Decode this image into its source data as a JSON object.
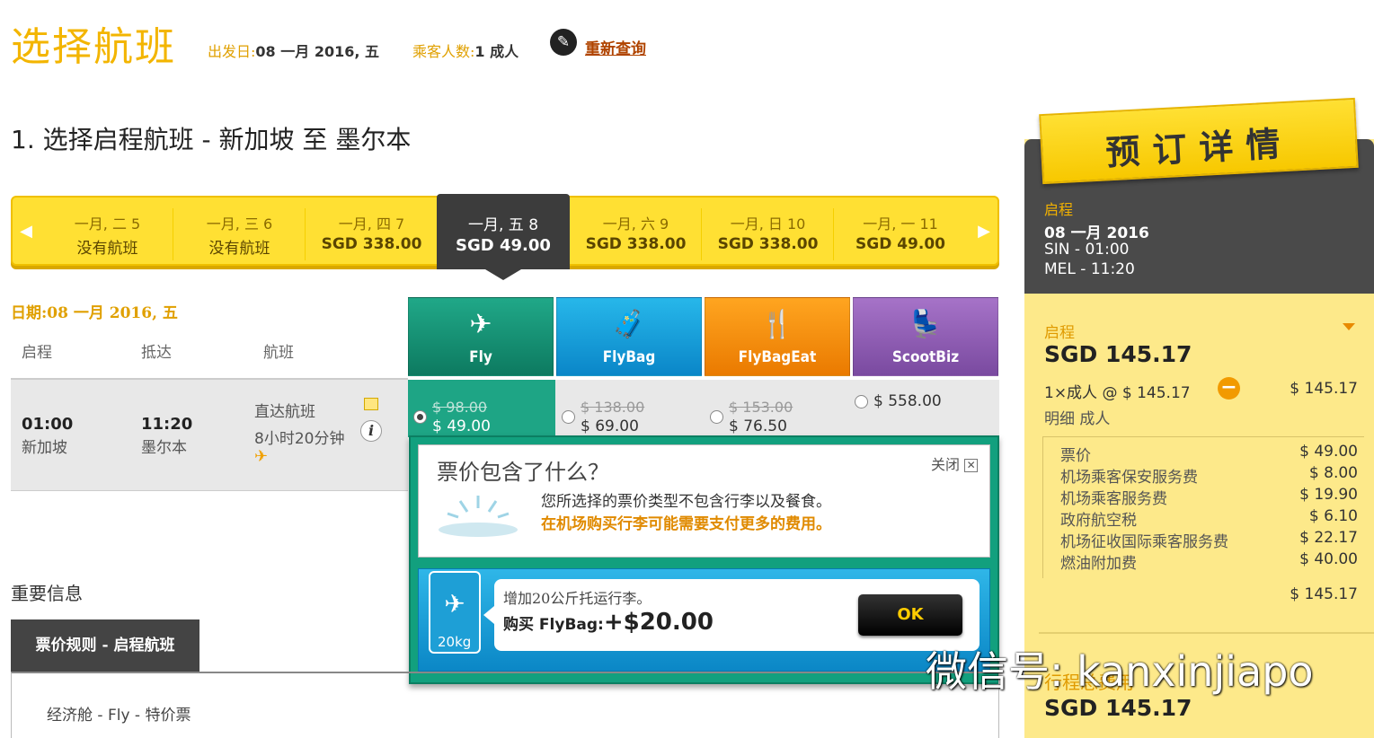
{
  "header": {
    "title": "选择航班",
    "depart_label": "出发日:",
    "depart_value": "08 一月 2016, 五",
    "pax_label": "乘客人数:",
    "pax_value": "1 成人",
    "research_link": "重新查询",
    "research_icon": "pencil-icon"
  },
  "section_title": "1. 选择启程航班 -  新加坡  至  墨尔本",
  "date_strip": {
    "prev_arrow": "◀",
    "next_arrow": "▶",
    "dates": [
      {
        "day": "一月, 二 5",
        "price": "没有航班"
      },
      {
        "day": "一月, 三 6",
        "price": "没有航班"
      },
      {
        "day": "一月, 四 7",
        "price": "SGD 338.00"
      },
      {
        "day": "一月, 五 8",
        "price": "SGD 49.00"
      },
      {
        "day": "一月, 六 9",
        "price": "SGD 338.00"
      },
      {
        "day": "一月, 日 10",
        "price": "SGD 338.00"
      },
      {
        "day": "一月, 一 11",
        "price": "SGD 49.00"
      }
    ],
    "selected_index": 3
  },
  "flight_table": {
    "date_label": "日期:08 一月 2016, 五",
    "columns": [
      "启程",
      "抵达",
      "航班"
    ],
    "flight": {
      "depart_time": "01:00",
      "depart_city": "新加坡",
      "arrive_time": "11:20",
      "arrive_city": "墨尔本",
      "flight_type": "直达航班",
      "duration": "8小时20分钟"
    }
  },
  "fares": [
    {
      "name": "Fly",
      "icon": "plane-icon",
      "old": "$ 98.00",
      "new": "$ 49.00",
      "selected": true,
      "color": "#15947a"
    },
    {
      "name": "FlyBag",
      "icon": "suitcase-icon",
      "old": "$ 138.00",
      "new": "$ 69.00",
      "selected": false,
      "color": "#1aa2dc"
    },
    {
      "name": "FlyBagEat",
      "icon": "meal-suitcase-icon",
      "old": "$ 153.00",
      "new": "$ 76.50",
      "selected": false,
      "color": "#f68e00"
    },
    {
      "name": "ScootBiz",
      "icon": "seat-icon",
      "old": "",
      "new": "$ 558.00",
      "selected": false,
      "color": "#8c5cb4"
    }
  ],
  "popup": {
    "title": "票价包含了什么？",
    "close_label": "关闭",
    "line1": "您所选择的票价类型不包含行李以及餐食。",
    "line2": "在机场购买行李可能需要支付更多的费用。",
    "upsell_line1": "增加20公斤托运行李。",
    "upsell_buy": "购买 FlyBag:",
    "upsell_price": "+$20.00",
    "bag_label": "20kg",
    "ok_label": "OK"
  },
  "important": {
    "title": "重要信息",
    "tab": "票价规则 - 启程航班",
    "fare_class": "经济舱 - Fly - 特价票"
  },
  "booking": {
    "banner": "预订详情",
    "leg_label": "启程",
    "leg_date": "08 一月 2016",
    "leg_dep": "SIN - 01:00",
    "leg_arr": "MEL - 11:20",
    "fare_label": "启程",
    "fare_total": "SGD 145.17",
    "pax_line": "1×成人 @ $ 145.17",
    "pax_amount": "$ 145.17",
    "detail_label": "明细 成人",
    "breakdown": [
      {
        "label": "票价",
        "amount": "$ 49.00"
      },
      {
        "label": "机场乘客保安服务费",
        "amount": "$ 8.00"
      },
      {
        "label": "机场乘客服务费",
        "amount": "$ 19.90"
      },
      {
        "label": "政府航空税",
        "amount": "$ 6.10"
      },
      {
        "label": "机场征收国际乘客服务费",
        "amount": "$ 22.17"
      },
      {
        "label": "燃油附加费",
        "amount": "$ 40.00"
      }
    ],
    "breakdown_total": "$ 145.17",
    "grand_label": "行程总费用",
    "grand_total": "SGD 145.17"
  },
  "watermark": "微信号: kanxinjiapo"
}
